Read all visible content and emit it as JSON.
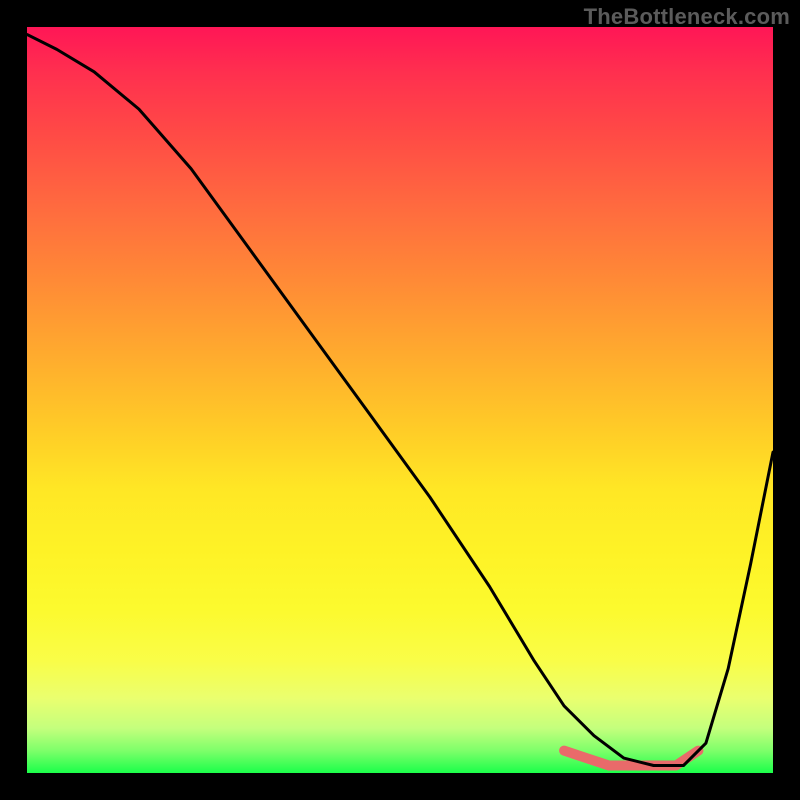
{
  "watermark": "TheBottleneck.com",
  "chart_data": {
    "type": "line",
    "title": "",
    "xlabel": "",
    "ylabel": "",
    "xlim": [
      0,
      100
    ],
    "ylim": [
      0,
      100
    ],
    "series": [
      {
        "name": "main-curve",
        "x": [
          0,
          4,
          9,
          15,
          22,
          30,
          38,
          46,
          54,
          62,
          68,
          72,
          76,
          80,
          84,
          88,
          91,
          94,
          97,
          100
        ],
        "values": [
          99,
          97,
          94,
          89,
          81,
          70,
          59,
          48,
          37,
          25,
          15,
          9,
          5,
          2,
          1,
          1,
          4,
          14,
          28,
          43
        ]
      },
      {
        "name": "bottom-highlight",
        "x": [
          72,
          75,
          78,
          81,
          84,
          87,
          90
        ],
        "values": [
          3,
          2,
          1,
          1,
          1,
          1,
          3
        ]
      }
    ],
    "colors": {
      "curve": "#000000",
      "highlight": "#e96a6a"
    }
  }
}
